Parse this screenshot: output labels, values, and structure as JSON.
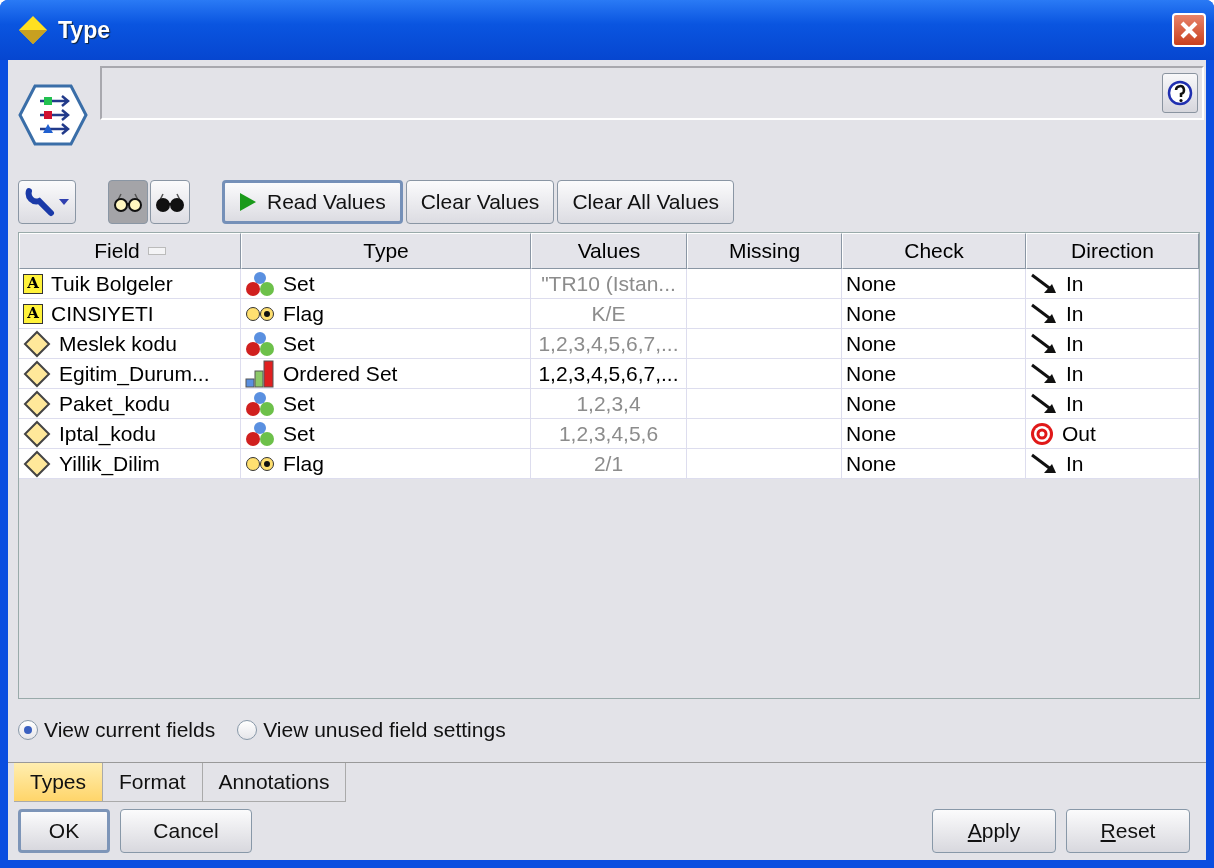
{
  "window": {
    "title": "Type"
  },
  "toolbar": {
    "view_toggles": [
      {
        "kind": "show",
        "selected": true
      },
      {
        "kind": "hide",
        "selected": false
      }
    ],
    "buttons": [
      {
        "label": "Read Values",
        "kind": "play",
        "focused": true
      },
      {
        "label": "Clear Values",
        "kind": "plain",
        "focused": false
      },
      {
        "label": "Clear All Values",
        "kind": "plain",
        "focused": false
      }
    ]
  },
  "table": {
    "columns": [
      {
        "label": "Field",
        "sorted": true
      },
      {
        "label": "Type",
        "sorted": false
      },
      {
        "label": "Values",
        "sorted": false
      },
      {
        "label": "Missing",
        "sorted": false
      },
      {
        "label": "Check",
        "sorted": false
      },
      {
        "label": "Direction",
        "sorted": false
      }
    ],
    "rows": [
      {
        "field": {
          "kind": "string",
          "icon_text": "A",
          "text": "Tuik Bolgeler"
        },
        "type": {
          "kind": "set",
          "text": "Set"
        },
        "values": {
          "text": "\"TR10 (Istan...",
          "dimmed": true
        },
        "check": "None",
        "direction": {
          "kind": "in",
          "text": "In"
        }
      },
      {
        "field": {
          "kind": "string",
          "icon_text": "A",
          "text": "CINSIYETI"
        },
        "type": {
          "kind": "flag",
          "text": "Flag"
        },
        "values": {
          "text": "K/E",
          "dimmed": true
        },
        "check": "None",
        "direction": {
          "kind": "in",
          "text": "In"
        }
      },
      {
        "field": {
          "kind": "numeric",
          "text": "Meslek kodu"
        },
        "type": {
          "kind": "set",
          "text": "Set"
        },
        "values": {
          "text": "1,2,3,4,5,6,7,...",
          "dimmed": true
        },
        "check": "None",
        "direction": {
          "kind": "in",
          "text": "In"
        }
      },
      {
        "field": {
          "kind": "numeric",
          "text": "Egitim_Durum..."
        },
        "type": {
          "kind": "ordered_set",
          "text": "Ordered Set"
        },
        "values": {
          "text": "1,2,3,4,5,6,7,...",
          "dimmed": false
        },
        "check": "None",
        "direction": {
          "kind": "in",
          "text": "In"
        }
      },
      {
        "field": {
          "kind": "numeric",
          "text": "Paket_kodu"
        },
        "type": {
          "kind": "set",
          "text": "Set"
        },
        "values": {
          "text": "1,2,3,4",
          "dimmed": true
        },
        "check": "None",
        "direction": {
          "kind": "in",
          "text": "In"
        }
      },
      {
        "field": {
          "kind": "numeric",
          "text": "Iptal_kodu"
        },
        "type": {
          "kind": "set",
          "text": "Set"
        },
        "values": {
          "text": "1,2,3,4,5,6",
          "dimmed": true
        },
        "check": "None",
        "direction": {
          "kind": "out",
          "text": "Out"
        }
      },
      {
        "field": {
          "kind": "numeric",
          "text": "Yillik_Dilim"
        },
        "type": {
          "kind": "flag",
          "text": "Flag"
        },
        "values": {
          "text": "2/1",
          "dimmed": true
        },
        "check": "None",
        "direction": {
          "kind": "in",
          "text": "In"
        }
      }
    ]
  },
  "view_options": [
    {
      "label": "View current fields",
      "selected": true
    },
    {
      "label": "View unused field settings",
      "selected": false
    }
  ],
  "tabs": [
    {
      "label": "Types",
      "selected": true
    },
    {
      "label": "Format",
      "selected": false
    },
    {
      "label": "Annotations",
      "selected": false
    }
  ],
  "buttons_left": [
    {
      "label": "OK",
      "default": true
    },
    {
      "label": "Cancel",
      "default": false
    }
  ],
  "buttons_right": [
    {
      "label": "Apply",
      "mnemonic_underlined": true
    },
    {
      "label": "Reset",
      "mnemonic_underlined": true
    }
  ]
}
